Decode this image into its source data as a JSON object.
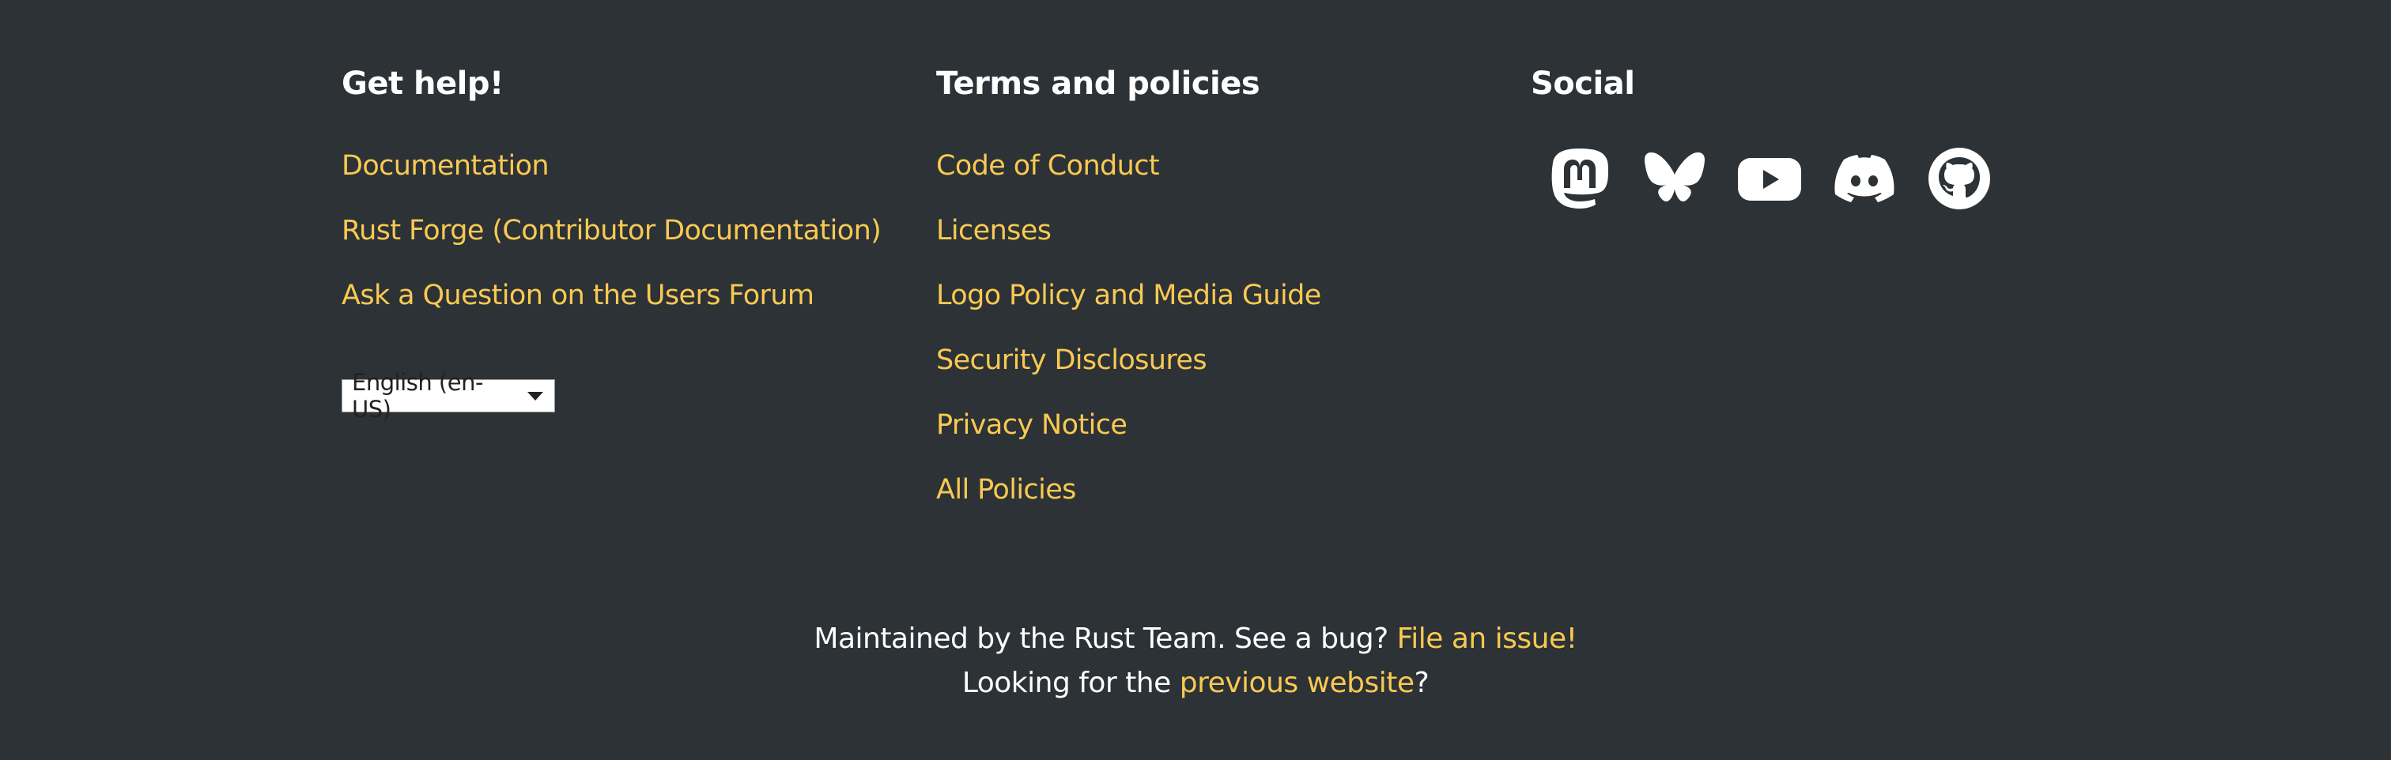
{
  "help": {
    "heading": "Get help!",
    "links": [
      {
        "label": "Documentation"
      },
      {
        "label": "Rust Forge (Contributor Documentation)"
      },
      {
        "label": "Ask a Question on the Users Forum"
      }
    ],
    "language_selected": "English (en-US)"
  },
  "terms": {
    "heading": "Terms and policies",
    "links": [
      {
        "label": "Code of Conduct"
      },
      {
        "label": "Licenses"
      },
      {
        "label": "Logo Policy and Media Guide"
      },
      {
        "label": "Security Disclosures"
      },
      {
        "label": "Privacy Notice"
      },
      {
        "label": "All Policies"
      }
    ]
  },
  "social": {
    "heading": "Social",
    "icons": [
      "mastodon-icon",
      "bluesky-icon",
      "youtube-icon",
      "discord-icon",
      "github-icon"
    ]
  },
  "bottom": {
    "line1_text": "Maintained by the Rust Team. See a bug?",
    "line1_link": "File an issue!",
    "line2_prefix": "Looking for the",
    "line2_link": "previous website",
    "line2_suffix": "?"
  },
  "colors": {
    "background": "#2c3236",
    "link": "#f9c952",
    "text": "#ffffff"
  }
}
